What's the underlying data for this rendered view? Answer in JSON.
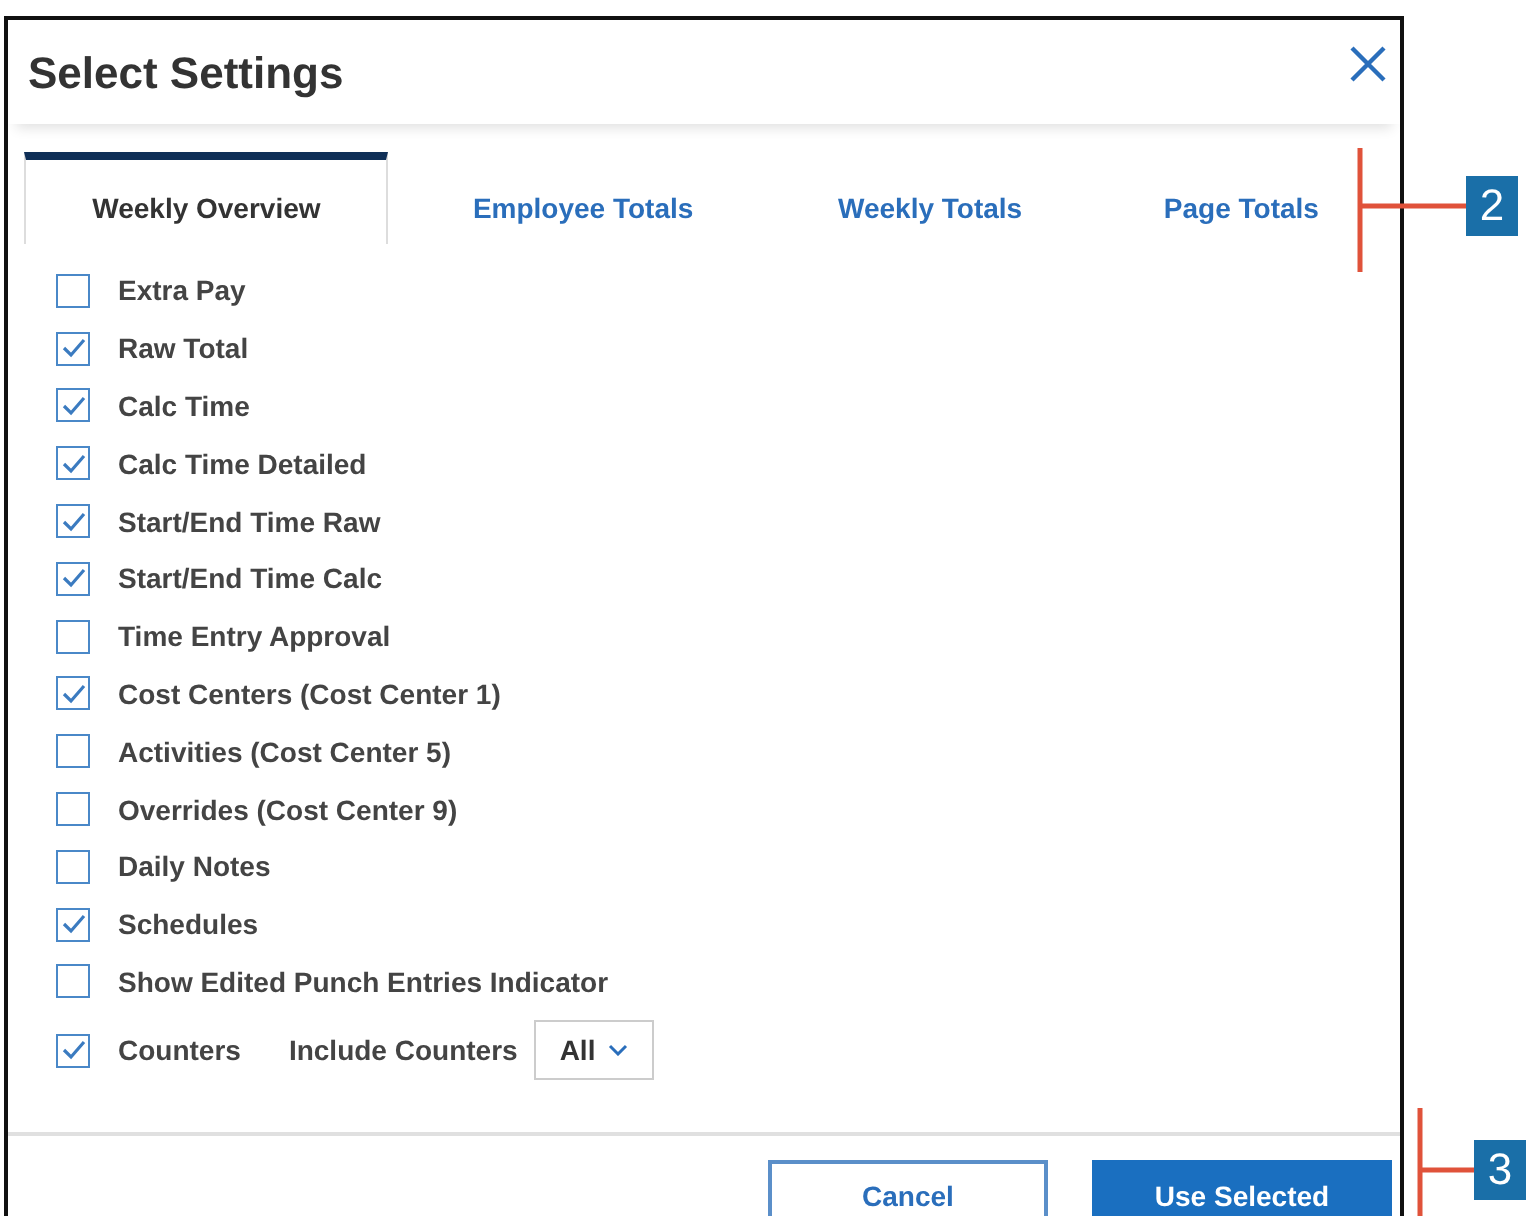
{
  "dialog": {
    "title": "Select Settings"
  },
  "tabs": [
    {
      "label": "Weekly Overview",
      "selected": true
    },
    {
      "label": "Employee Totals",
      "selected": false
    },
    {
      "label": "Weekly Totals",
      "selected": false
    },
    {
      "label": "Page Totals",
      "selected": false
    }
  ],
  "options": [
    {
      "label": "Extra Pay",
      "checked": false
    },
    {
      "label": "Raw Total",
      "checked": true
    },
    {
      "label": "Calc Time",
      "checked": true
    },
    {
      "label": "Calc Time Detailed",
      "checked": true
    },
    {
      "label": "Start/End Time Raw",
      "checked": true
    },
    {
      "label": "Start/End Time Calc",
      "checked": true
    },
    {
      "label": "Time Entry Approval",
      "checked": false
    },
    {
      "label": "Cost Centers (Cost Center 1)",
      "checked": true
    },
    {
      "label": "Activities (Cost Center 5)",
      "checked": false
    },
    {
      "label": "Overrides (Cost Center 9)",
      "checked": false
    },
    {
      "label": "Daily Notes",
      "checked": false
    },
    {
      "label": "Schedules",
      "checked": true
    },
    {
      "label": "Show Edited Punch Entries Indicator",
      "checked": false
    }
  ],
  "counters": {
    "label": "Counters",
    "checked": true,
    "select_label": "Include Counters",
    "select_value": "All"
  },
  "buttons": [
    {
      "label": "Cancel",
      "kind": "secondary"
    },
    {
      "label": "Use Selected",
      "kind": "primary"
    }
  ],
  "callouts": [
    {
      "label": "2"
    },
    {
      "label": "3"
    }
  ]
}
